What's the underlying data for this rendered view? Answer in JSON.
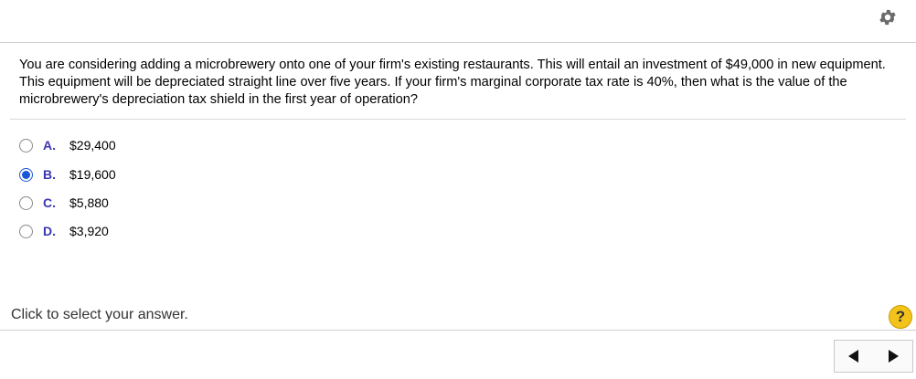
{
  "question": {
    "text": "You are considering adding a microbrewery onto one of your firm's existing restaurants.  This will entail an investment of $49,000 in new equipment.  This equipment will be depreciated straight line over five years.  If your firm's marginal corporate tax rate is 40%, then what is the value of the microbrewery's depreciation tax shield in the first year of operation?"
  },
  "options": [
    {
      "letter": "A.",
      "text": "$29,400",
      "selected": false
    },
    {
      "letter": "B.",
      "text": "$19,600",
      "selected": true
    },
    {
      "letter": "C.",
      "text": "$5,880",
      "selected": false
    },
    {
      "letter": "D.",
      "text": "$3,920",
      "selected": false
    }
  ],
  "footer": {
    "status_text": "Click to select your answer.",
    "help_label": "?"
  },
  "icons": {
    "settings": "gear-icon",
    "help": "help-icon",
    "prev": "triangle-left-icon",
    "next": "triangle-right-icon"
  },
  "colors": {
    "selected_radio": "#1a57d6",
    "option_letter": "#3b37b0",
    "help_button": "#f3c31b"
  }
}
